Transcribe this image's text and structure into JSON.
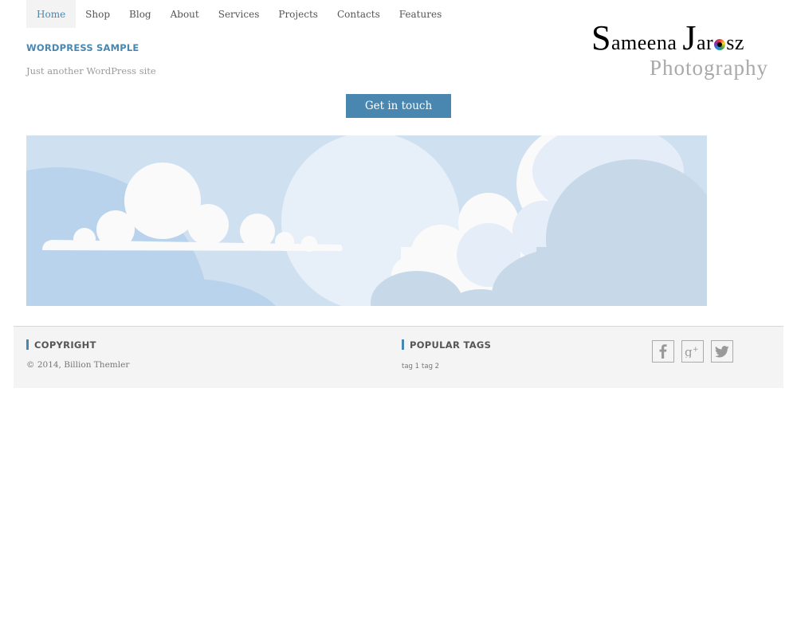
{
  "nav": {
    "items": [
      {
        "label": "Home",
        "active": true
      },
      {
        "label": "Shop"
      },
      {
        "label": "Blog"
      },
      {
        "label": "About"
      },
      {
        "label": "Services"
      },
      {
        "label": "Projects"
      },
      {
        "label": "Contacts"
      },
      {
        "label": "Features"
      }
    ]
  },
  "site": {
    "title": "WORDPRESS SAMPLE",
    "tagline": "Just another WordPress site"
  },
  "logo": {
    "name_part1": "ameena",
    "name_s": "S",
    "name_j": "J",
    "name_part2_a": "ar",
    "name_part2_b": "sz",
    "subtitle": "Photography"
  },
  "cta": {
    "label": "Get in touch"
  },
  "footer": {
    "copyright_heading": "COPYRIGHT",
    "copyright_text": "© 2014, Billion Themler",
    "tags_heading": "POPULAR TAGS",
    "tags": [
      "tag 1",
      "tag 2"
    ],
    "social": [
      "facebook-icon",
      "google-plus-icon",
      "twitter-icon"
    ]
  },
  "colors": {
    "accent": "#4a87b0",
    "footer_bg": "#f4f4f4",
    "banner_sky": "#cfe0f1"
  }
}
